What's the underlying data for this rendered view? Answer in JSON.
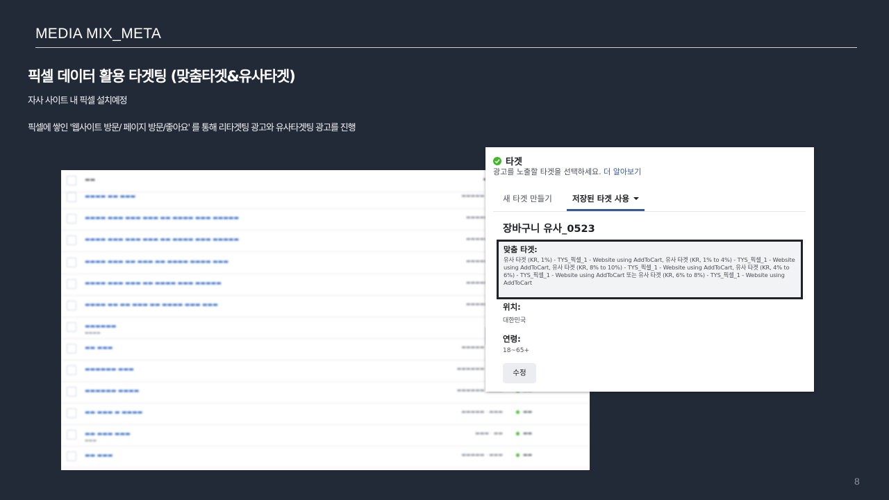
{
  "slide": {
    "header": "MEDIA MIX_META",
    "title": "픽셀 데이터 활용 타겟팅 (맞춤타겟&유사타겟)",
    "subtitle1": "자사 사이트 내 픽셀 설치예정",
    "subtitle2": "픽셀에 쌓인 '웹사이트 방문/ 페이지 방문/좋아요' 를 통해 리타겟팅 광고와 유사타겟팅 광고를 진행",
    "page_number": "8"
  },
  "target_card": {
    "heading": "타겟",
    "description": "광고를 노출할 타겟을 선택하세요.",
    "learn_more": "더 알아보기",
    "tabs": [
      "새 타겟 만들기",
      "저장된 타겟 사용"
    ],
    "audience_name": "장바구니 유사_0523",
    "custom_label": "맞춤 타겟:",
    "custom_text": "유사 타겟 (KR, 1%) - TYS_픽셀_1 - Website using AddToCart, 유사 타겟 (KR, 1% to 4%) - TYS_픽셀_1 - Website using AddToCart, 유사 타겟 (KR, 8% to 10%) - TYS_픽셀_1 - Website using AddToCart, 유사 타겟 (KR, 4% to 6%) - TYS_픽셀_1 - Website using AddToCart 또는 유사 타겟 (KR, 6% to 8%) - TYS_픽셀_1 - Website using AddToCart",
    "location_label": "위치:",
    "location_value": "대한민국",
    "age_label": "연령:",
    "age_value": "18~65+",
    "edit_button": "수정",
    "check_color": "#42b72a",
    "link_color": "#385898"
  }
}
